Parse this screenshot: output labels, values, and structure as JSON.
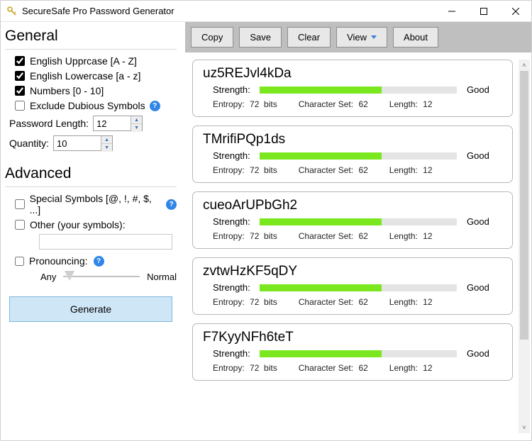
{
  "window": {
    "title": "SecureSafe Pro Password Generator"
  },
  "sidebar": {
    "section_general": "General",
    "section_advanced": "Advanced",
    "opts": {
      "uppercase": {
        "label": "English Upprcase [A - Z]",
        "checked": true
      },
      "lowercase": {
        "label": "English Lowercase [a - z]",
        "checked": true
      },
      "numbers": {
        "label": "Numbers [0 - 10]",
        "checked": true
      },
      "exclude": {
        "label": "Exclude Dubious Symbols",
        "checked": false
      },
      "special": {
        "label": "Special Symbols [@, !, #, $, ...]",
        "checked": false
      },
      "other": {
        "label": "Other (your symbols):",
        "checked": false
      }
    },
    "length_label": "Password Length:",
    "length_value": "12",
    "qty_label": "Quantity:",
    "qty_value": "10",
    "pronounce_label": "Pronouncing:",
    "slider_left": "Any",
    "slider_right": "Normal",
    "generate": "Generate"
  },
  "toolbar": {
    "copy": "Copy",
    "save": "Save",
    "clear": "Clear",
    "view": "View",
    "about": "About"
  },
  "card_labels": {
    "strength": "Strength:",
    "entropy": "Entropy:",
    "entropy_unit": "bits",
    "charset": "Character Set:",
    "length": "Length:"
  },
  "results": [
    {
      "pw": "uz5REJvl4kDa",
      "strength_pct": 62,
      "verdict": "Good",
      "entropy": "72",
      "charset": "62",
      "length": "12"
    },
    {
      "pw": "TMrifiPQp1ds",
      "strength_pct": 62,
      "verdict": "Good",
      "entropy": "72",
      "charset": "62",
      "length": "12"
    },
    {
      "pw": "cueoArUPbGh2",
      "strength_pct": 62,
      "verdict": "Good",
      "entropy": "72",
      "charset": "62",
      "length": "12"
    },
    {
      "pw": "zvtwHzKF5qDY",
      "strength_pct": 62,
      "verdict": "Good",
      "entropy": "72",
      "charset": "62",
      "length": "12"
    },
    {
      "pw": "F7KyyNFh6teT",
      "strength_pct": 62,
      "verdict": "Good",
      "entropy": "72",
      "charset": "62",
      "length": "12"
    }
  ]
}
